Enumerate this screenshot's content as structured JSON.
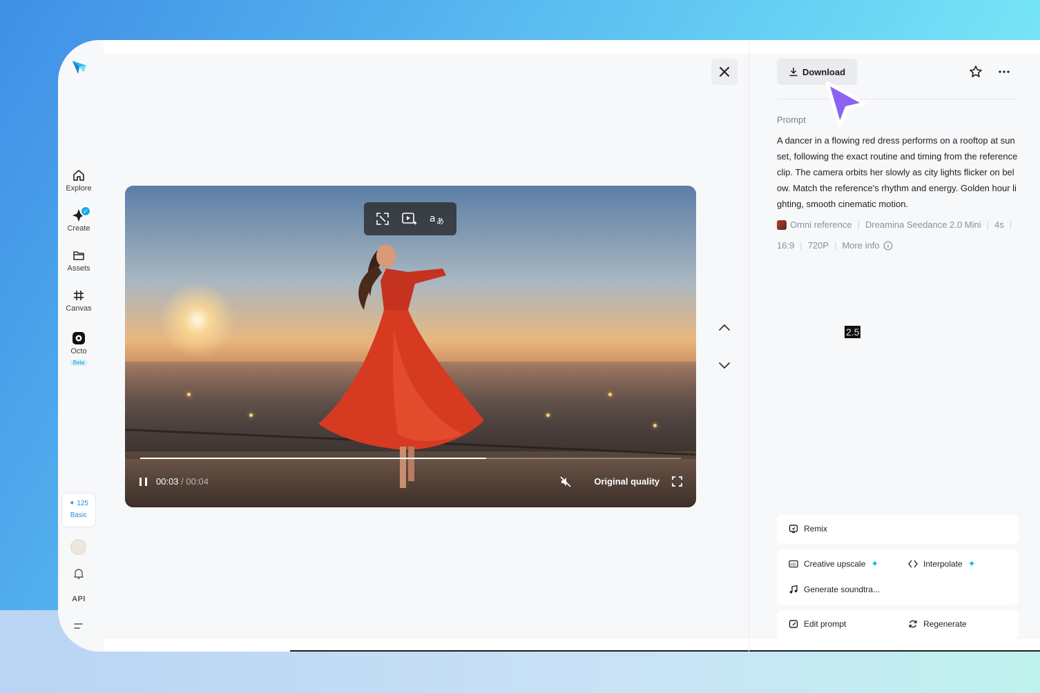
{
  "colors": {
    "accent": "#12b8d8",
    "cursor": "#8a63f2",
    "beta": "#1a8fd8"
  },
  "sidebar": {
    "items": [
      {
        "label": "Explore",
        "icon": "home-icon"
      },
      {
        "label": "Create",
        "icon": "create-sparkle-icon"
      },
      {
        "label": "Assets",
        "icon": "folder-icon"
      },
      {
        "label": "Canvas",
        "icon": "canvas-frame-icon"
      },
      {
        "label": "Octo",
        "icon": "octo-icon",
        "badge": "Beta"
      }
    ],
    "credits": {
      "amount": "125",
      "plan": "Basic"
    },
    "api_label": "API"
  },
  "video": {
    "current_time": "00:03",
    "duration": "00:04",
    "time_separator": " / ",
    "progress_fraction": 0.64,
    "quality_label": "Original quality",
    "tools": [
      "crop-reframe-icon",
      "video-enhance-icon",
      "translate-icon"
    ]
  },
  "panel": {
    "download_label": "Download",
    "prompt_label": "Prompt",
    "prompt_text": "A dancer in a flowing red dress performs on a rooftop at sunset, following the exact routine and timing from the reference clip. The camera orbits her slowly as city lights flicker on below. Match the reference's rhythm and energy. Golden hour lighting, smooth cinematic motion.",
    "meta_row1": [
      "Omni reference",
      "Dreamina Seedance 2.0 Mini",
      "4s"
    ],
    "meta_row2": [
      "16:9",
      "720P",
      "More info"
    ],
    "badge": "2.5",
    "actions": {
      "remix": "Remix",
      "creative_upscale": "Creative upscale",
      "interpolate": "Interpolate",
      "generate_soundtrack": "Generate soundtra...",
      "edit_prompt": "Edit prompt",
      "regenerate": "Regenerate"
    }
  }
}
